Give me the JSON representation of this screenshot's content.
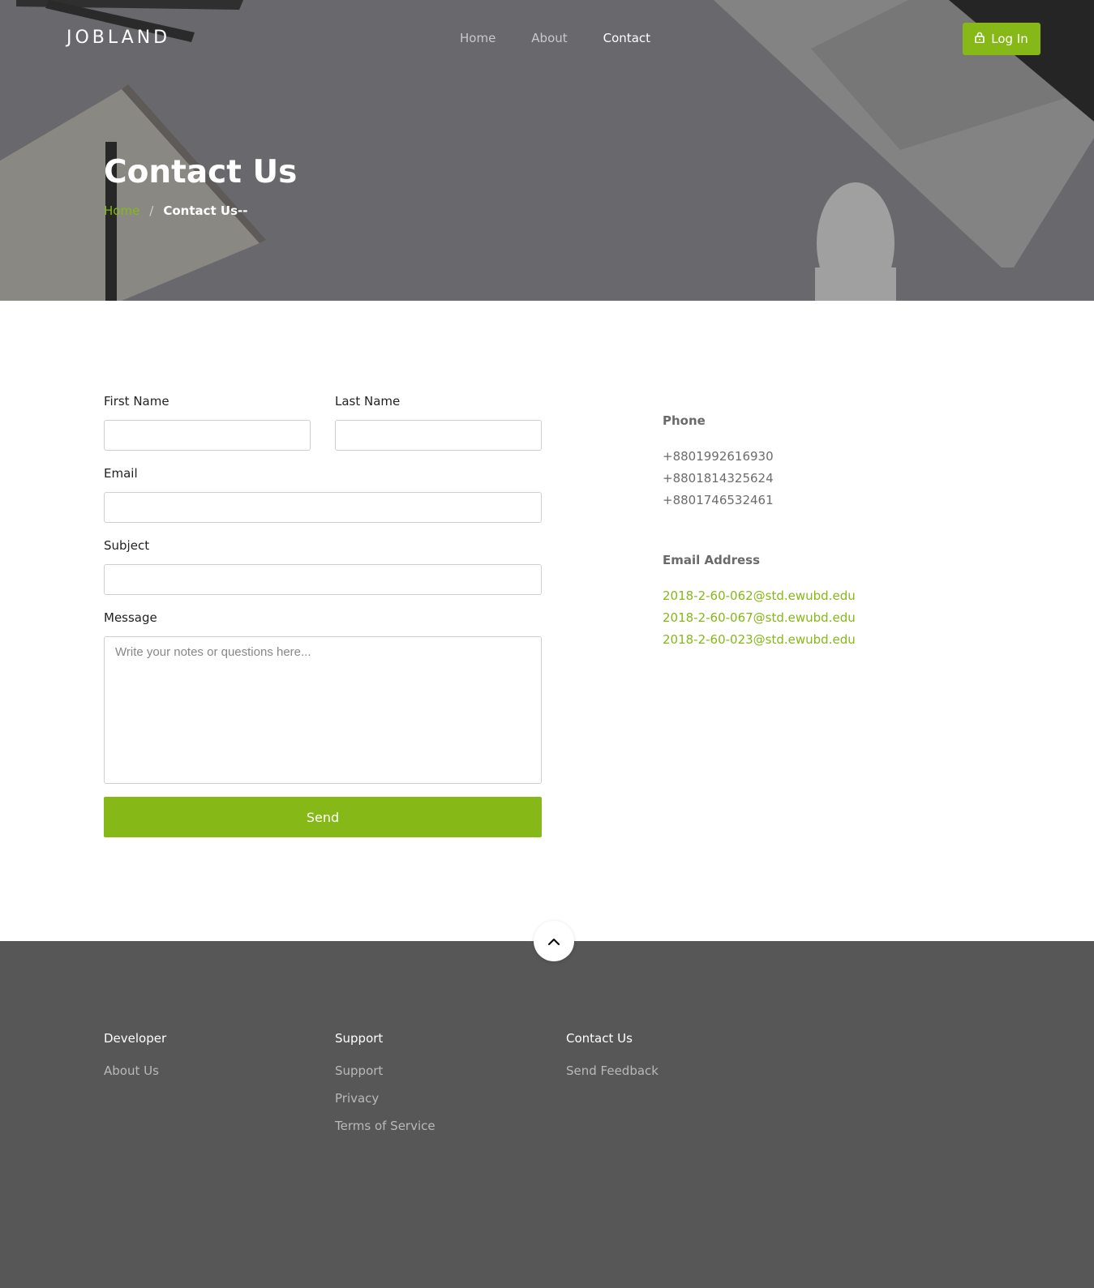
{
  "header": {
    "logo": "JOBLAND",
    "nav": [
      {
        "label": "Home"
      },
      {
        "label": "About"
      },
      {
        "label": "Contact"
      }
    ],
    "login_label": "Log In",
    "login_icon": "lock-icon"
  },
  "hero": {
    "title": "Contact Us",
    "breadcrumb": {
      "home": "Home",
      "separator": "/",
      "current": "Contact Us--"
    }
  },
  "form": {
    "first_name_label": "First Name",
    "first_name_value": "",
    "last_name_label": "Last Name",
    "last_name_value": "",
    "email_label": "Email",
    "email_value": "",
    "subject_label": "Subject",
    "subject_value": "",
    "message_label": "Message",
    "message_placeholder": "Write your notes or questions here...",
    "send_label": "Send"
  },
  "contact_info": {
    "phone_heading": "Phone",
    "phones": [
      "+8801992616930",
      "+8801814325624",
      "+8801746532461"
    ],
    "email_heading": "Email Address",
    "emails": [
      "2018-2-60-062@std.ewubd.edu",
      "2018-2-60-067@std.ewubd.edu",
      "2018-2-60-023@std.ewubd.edu"
    ]
  },
  "footer": {
    "scroll_top_icon": "chevron-up-icon",
    "columns": [
      {
        "heading": "Developer",
        "links": [
          "About Us"
        ]
      },
      {
        "heading": "Support",
        "links": [
          "Support",
          "Privacy",
          "Terms of Service"
        ]
      },
      {
        "heading": "Contact Us",
        "links": [
          "Send Feedback"
        ]
      }
    ]
  },
  "colors": {
    "accent": "#86b817",
    "footer_bg": "#575757",
    "hero_overlay": "#77777a"
  }
}
